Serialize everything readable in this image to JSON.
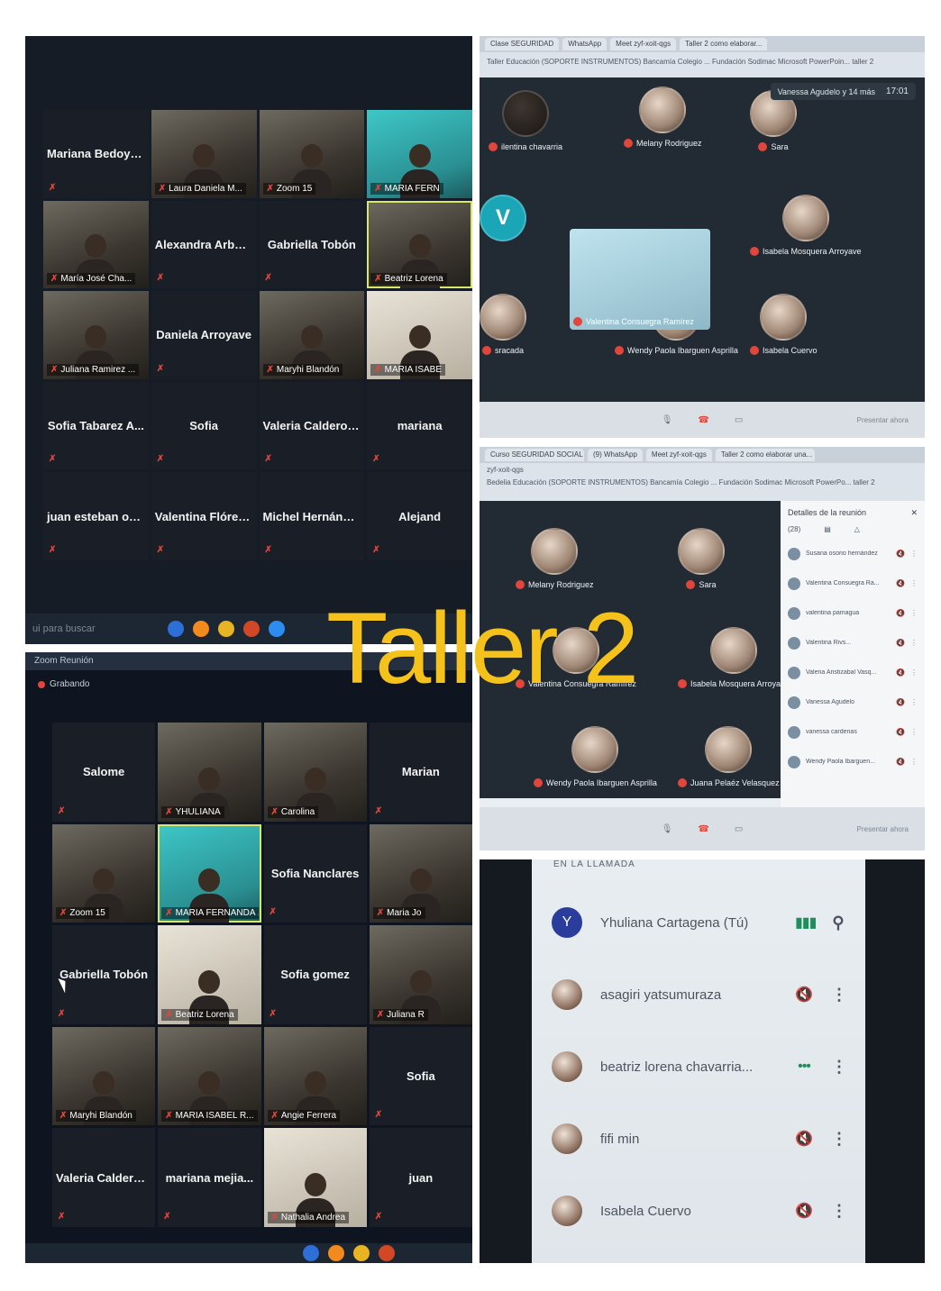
{
  "overlay": {
    "title": "Taller 2"
  },
  "zoom_top": {
    "search_placeholder": "ui para buscar",
    "tiles": [
      {
        "type": "name",
        "text": "Mariana Bedoya..."
      },
      {
        "type": "video",
        "text": "Laura Daniela M..."
      },
      {
        "type": "video",
        "text": "Zoom 15"
      },
      {
        "type": "video",
        "text": "MARIA FERN",
        "style": "teal"
      },
      {
        "type": "video",
        "text": "María José Cha..."
      },
      {
        "type": "name",
        "text": "Alexandra Arbol..."
      },
      {
        "type": "name",
        "text": "Gabriella Tobón"
      },
      {
        "type": "video",
        "text": "Beatriz Lorena",
        "active": true
      },
      {
        "type": "video",
        "text": "Juliana Ramirez ..."
      },
      {
        "type": "name",
        "text": "Daniela Arroyave"
      },
      {
        "type": "video",
        "text": "Maryhi Blandón"
      },
      {
        "type": "video",
        "text": "MARIA ISABE",
        "style": "light"
      },
      {
        "type": "name",
        "text": "Sofia Tabarez A..."
      },
      {
        "type": "name",
        "text": "Sofia"
      },
      {
        "type": "name",
        "text": "Valeria Calderon..."
      },
      {
        "type": "name",
        "text": "mariana"
      },
      {
        "type": "name",
        "text": "juan esteban oc..."
      },
      {
        "type": "name",
        "text": "Valentina Flórez..."
      },
      {
        "type": "name",
        "text": "Michel Hernández"
      },
      {
        "type": "name",
        "text": "Alejand"
      }
    ]
  },
  "zoom_bottom": {
    "window_title": "Zoom Reunión",
    "recording_label": "Grabando",
    "tiles": [
      {
        "type": "name",
        "text": "Salome"
      },
      {
        "type": "video",
        "text": "YHULIANA"
      },
      {
        "type": "video",
        "text": "Carolina"
      },
      {
        "type": "name",
        "text": "Marian"
      },
      {
        "type": "video",
        "text": "Zoom 15"
      },
      {
        "type": "video",
        "text": "MARIA FERNANDA ...",
        "style": "teal",
        "active": true
      },
      {
        "type": "name",
        "text": "Sofia Nanclares"
      },
      {
        "type": "video",
        "text": "Maria Jo"
      },
      {
        "type": "name",
        "text": "Gabriella Tobón"
      },
      {
        "type": "video",
        "text": "Beatriz Lorena",
        "style": "light"
      },
      {
        "type": "name",
        "text": "Sofia gomez"
      },
      {
        "type": "video",
        "text": "Juliana R"
      },
      {
        "type": "video",
        "text": "Maryhi Blandón"
      },
      {
        "type": "video",
        "text": "MARIA ISABEL R..."
      },
      {
        "type": "video",
        "text": "Angie Ferrera"
      },
      {
        "type": "name",
        "text": "Sofia"
      },
      {
        "type": "name",
        "text": "Valeria Calderon..."
      },
      {
        "type": "name",
        "text": "mariana mejia..."
      },
      {
        "type": "video",
        "text": "Nathalia Andrea",
        "style": "light"
      },
      {
        "type": "name",
        "text": "juan"
      }
    ]
  },
  "meet_top": {
    "tabs": [
      "Clase SEGURIDAD",
      "WhatsApp",
      "Meet zyf-xoit-qgs",
      "Taller 2 como elaborar..."
    ],
    "bookmarks": "Taller Educación   (SOPORTE INSTRUMENTOS)   Bancamía Colegio ...   Fundación Sodimac   Microsoft PowerPoin...   taller 2",
    "info_name": "Vanessa Agudelo y 14 más",
    "clock": "17:01",
    "participants": [
      {
        "label": "ilentina chavarria"
      },
      {
        "label": "Melany Rodriguez"
      },
      {
        "label": "Sara"
      },
      {
        "label": "V",
        "letter": true
      },
      {
        "label": "Valentina Consuegra Ramírez"
      },
      {
        "label": "Isabela Mosquera Arroyave"
      },
      {
        "label": "sracada"
      },
      {
        "label": "Wendy Paola Ibarguen Asprilla"
      },
      {
        "label": "Isabela Cuervo"
      }
    ],
    "present_label": "Presentar ahora"
  },
  "meet_details": {
    "tabs": [
      "Curso SEGURIDAD SOCIAL E...",
      "(9) WhatsApp",
      "Meet zyf-xoit-qgs",
      "Taller 2 como elaborar una..."
    ],
    "url": "zyf-xoit-qgs",
    "bookmarks": "Bedelia Educación   (SOPORTE INSTRUMENTOS)   Bancamía Colegio ...   Fundación Sodimac   Microsoft PowerPo...   taller 2",
    "panel_title": "Detalles de la reunión",
    "participant_count": "(28)",
    "participants": [
      "Susana osorio hernández",
      "Valentina Consuegra Ra...",
      "valentina pamagua",
      "Valentina Rivs...",
      "Valeria Aristizabal Vasq...",
      "Vanessa Agudelo",
      "vanessa cardenas",
      "Wendy Paola Ibarguen..."
    ],
    "tiles": [
      {
        "label": "Melany Rodriguez"
      },
      {
        "label": "Sara"
      },
      {
        "label": "Valentina Consuegra Ramírez"
      },
      {
        "label": "Isabela Mosquera Arroyave"
      },
      {
        "label": "Wendy Paola Ibarguen Asprilla"
      },
      {
        "label": "Juana Pelaéz Velasquez"
      }
    ],
    "present_label": "Presentar ahora"
  },
  "phone_list": {
    "header": "EN LA LLAMADA",
    "rows": [
      {
        "initial": "Y",
        "name": "Yhuliana Cartagena (Tú)",
        "status": "speaking",
        "action": "pin"
      },
      {
        "initial": "",
        "name": "asagiri yatsumuraza",
        "status": "muted",
        "action": "menu"
      },
      {
        "initial": "",
        "name": "beatriz lorena chavarria...",
        "status": "dots",
        "action": "menu"
      },
      {
        "initial": "",
        "name": "fifi min",
        "status": "muted",
        "action": "menu"
      },
      {
        "initial": "",
        "name": "Isabela Cuervo",
        "status": "muted",
        "action": "menu"
      }
    ]
  }
}
